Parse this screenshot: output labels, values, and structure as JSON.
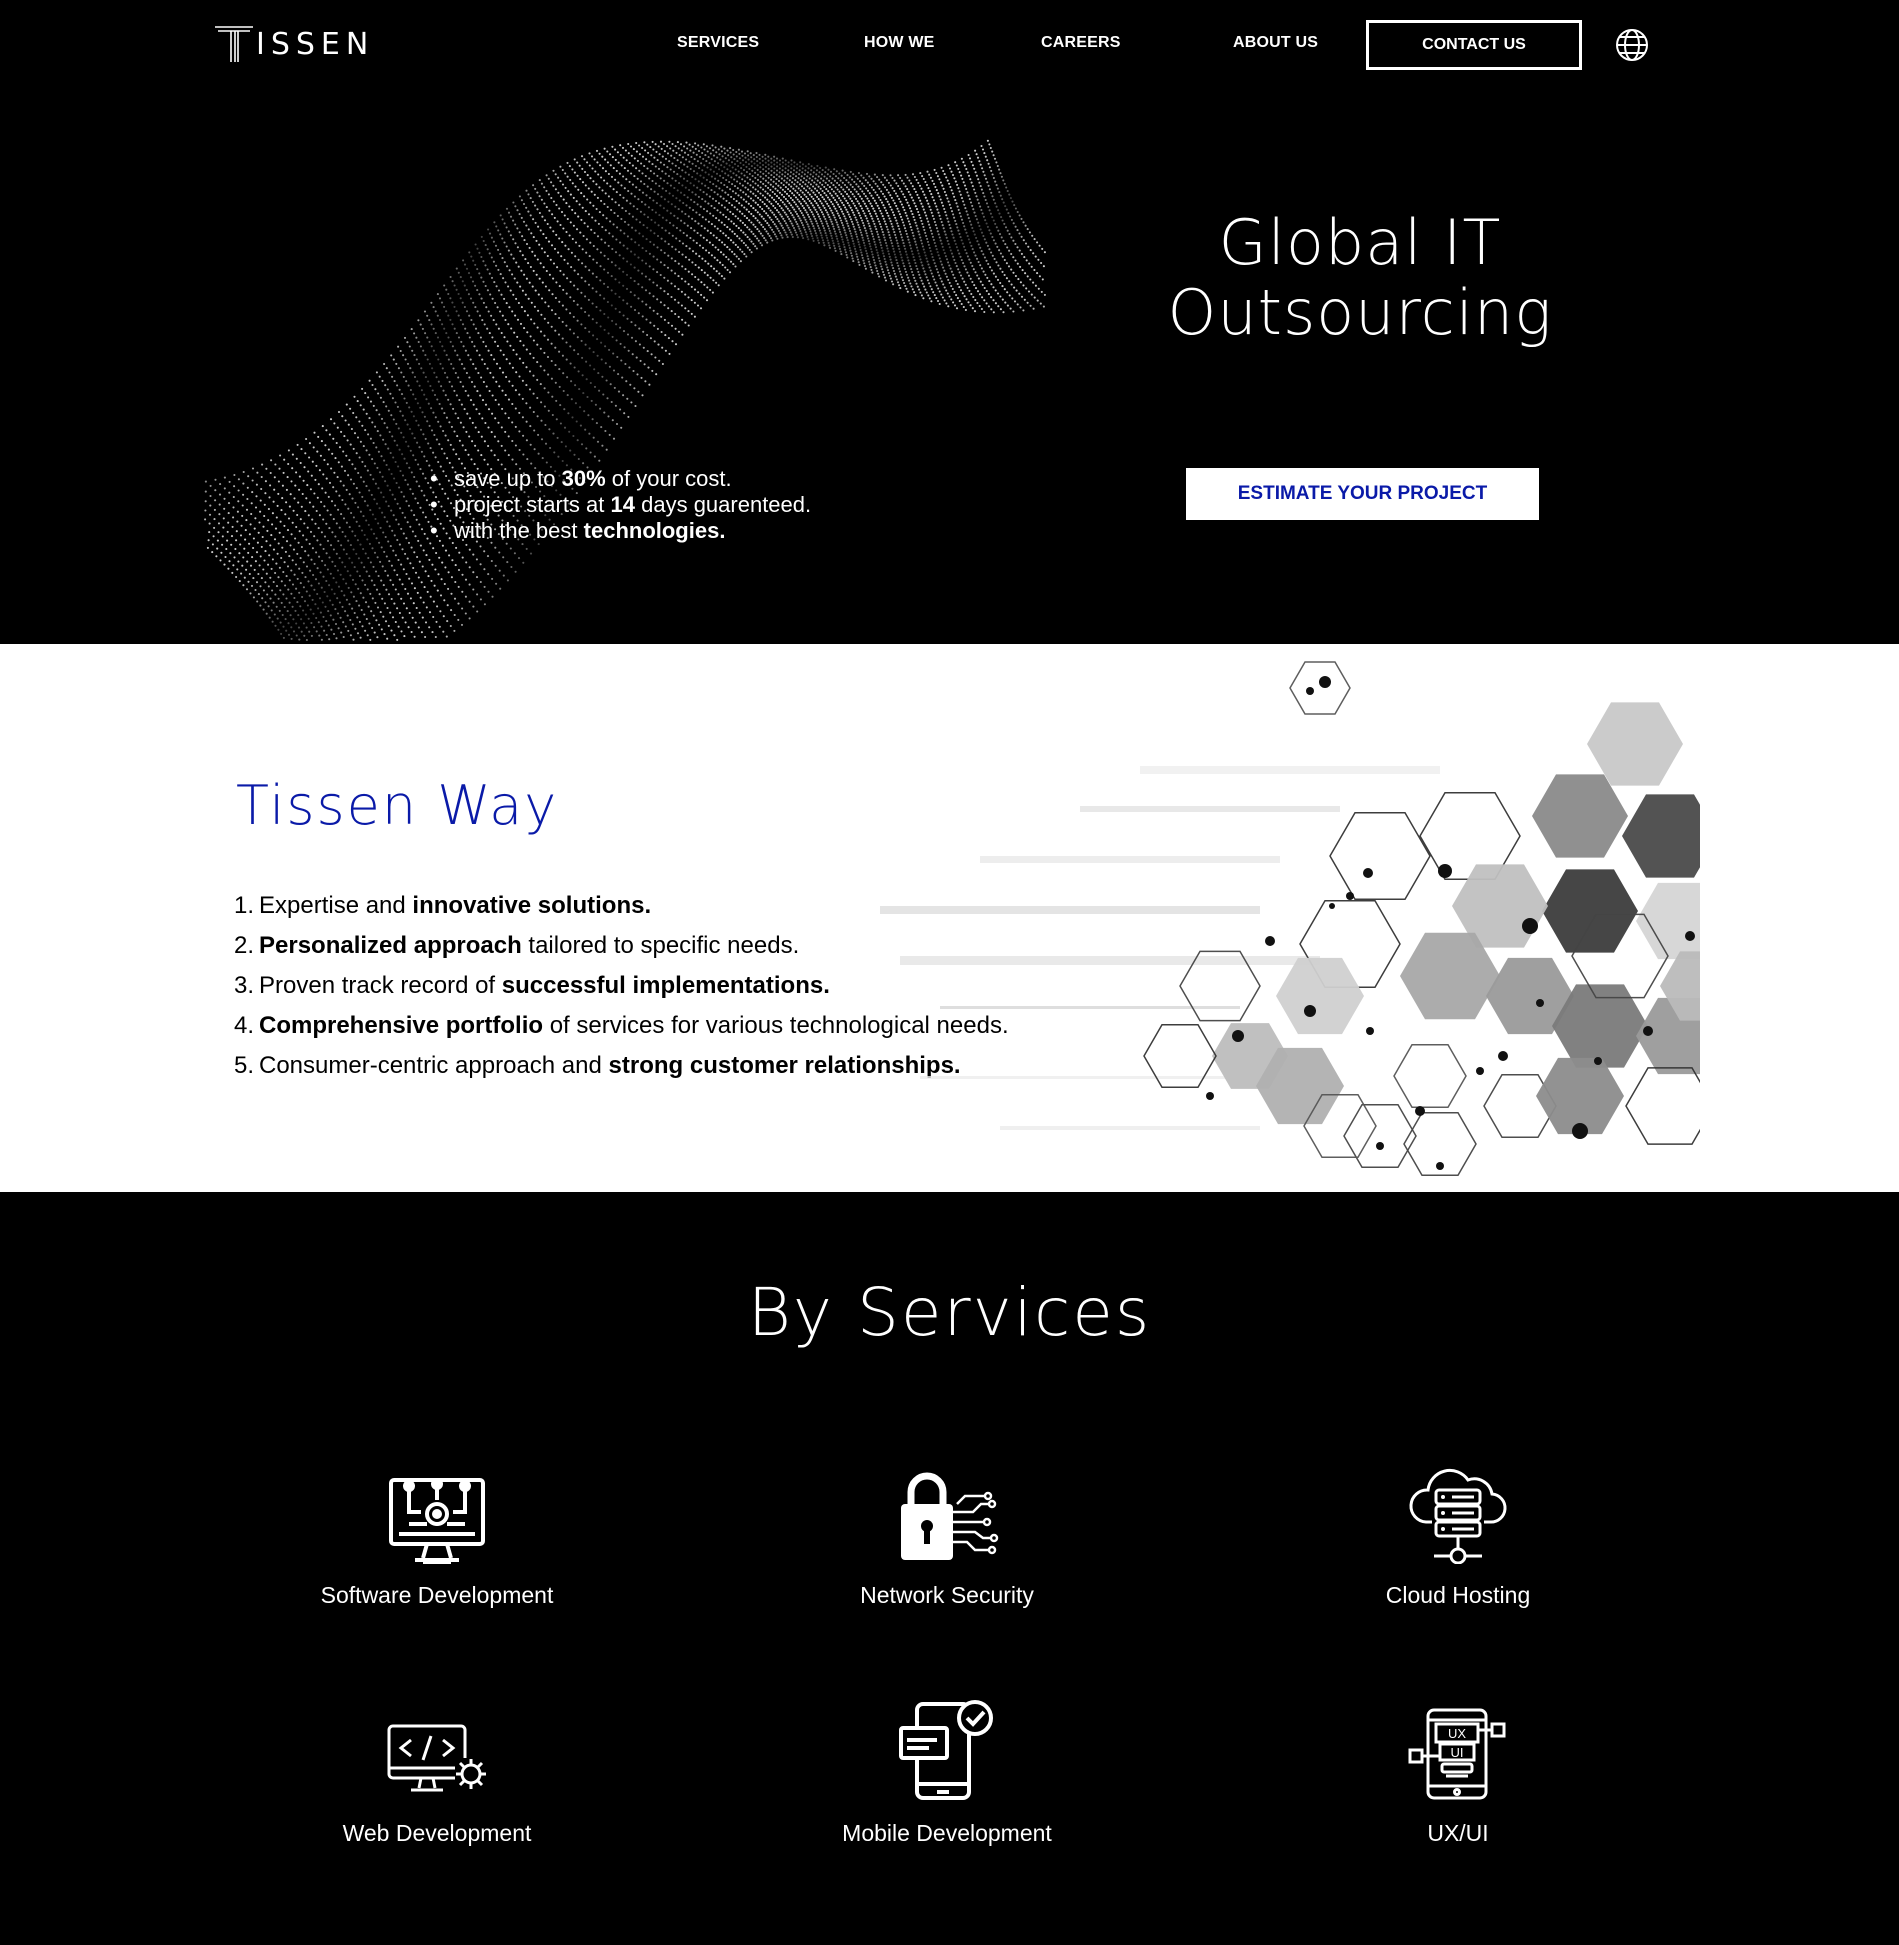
{
  "header": {
    "logo_text": "ISSEN",
    "nav": [
      "SERVICES",
      "HOW WE",
      "CAREERS",
      "ABOUT US"
    ],
    "contact_label": "CONTACT US"
  },
  "hero": {
    "title_line1": "Global IT",
    "title_line2": "Outsourcing",
    "cta_label": "ESTIMATE YOUR PROJECT",
    "bullets": [
      {
        "pre": "save up to ",
        "bold": "30%",
        "post": " of your cost."
      },
      {
        "pre": "project starts at ",
        "bold": "14",
        "post": " days guarenteed."
      },
      {
        "pre": "with the best ",
        "bold": "technologies.",
        "post": ""
      }
    ]
  },
  "way": {
    "title": "Tissen Way",
    "items": [
      {
        "num": "1.",
        "pre": "Expertise and ",
        "bold": "innovative solutions.",
        "post": ""
      },
      {
        "num": "2.",
        "pre": "",
        "bold": "Personalized approach",
        "post": " tailored to specific needs."
      },
      {
        "num": "3.",
        "pre": "Proven track record of ",
        "bold": "successful implementations.",
        "post": ""
      },
      {
        "num": "4.",
        "pre": "",
        "bold": "Comprehensive portfolio",
        "post": " of services for various technological needs."
      },
      {
        "num": "5.",
        "pre": "Consumer-centric approach and ",
        "bold": "strong customer relationships.",
        "post": ""
      }
    ]
  },
  "services": {
    "title": "By Services",
    "items": [
      {
        "label": "Software Development",
        "icon": "software-development-icon"
      },
      {
        "label": "Network Security",
        "icon": "padlock-circuit-icon"
      },
      {
        "label": "Cloud Hosting",
        "icon": "cloud-server-icon"
      },
      {
        "label": "Web Development",
        "icon": "monitor-code-gear-icon"
      },
      {
        "label": "Mobile Development",
        "icon": "smartphone-check-icon"
      },
      {
        "label": "UX/UI",
        "icon": "ux-ui-phone-icon"
      }
    ],
    "ux_icon_text": [
      "UX",
      "UI"
    ]
  },
  "colors": {
    "accent_blue": "#0a1aa8",
    "background_dark": "#000000",
    "background_light": "#ffffff"
  }
}
